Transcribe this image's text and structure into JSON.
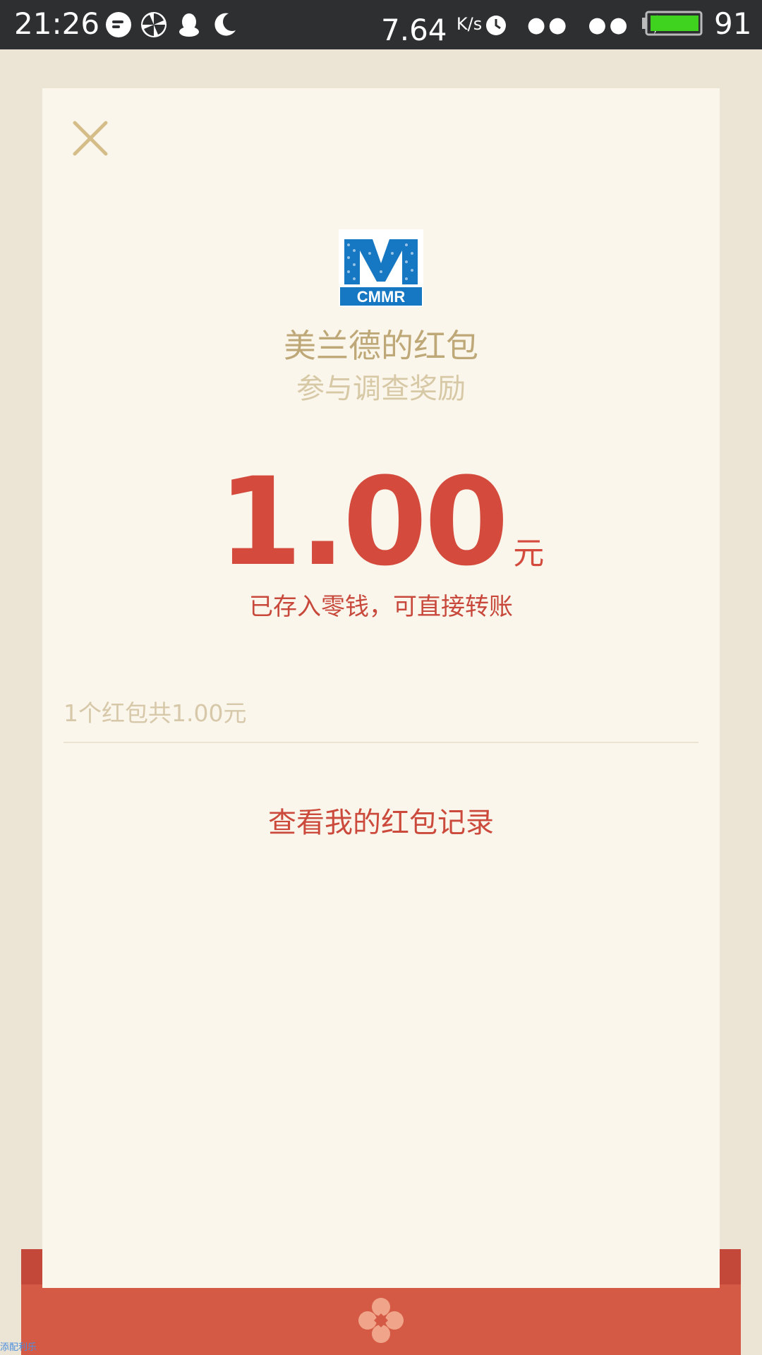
{
  "status_bar": {
    "time": "21:26",
    "net_speed": "7.64",
    "net_speed_unit": "K/s",
    "battery_level": "91",
    "battery_color": "#3fd21f",
    "icons": [
      "message-icon",
      "pinwheel-icon",
      "qq-icon",
      "moon-icon",
      "alarm-icon",
      "signal-dots-icon",
      "signal-dots-icon",
      "charging-icon",
      "battery-icon"
    ]
  },
  "packet": {
    "logo_text": "CMMR",
    "title": "美兰德的红包",
    "subtitle": "参与调查奖励",
    "amount": "1.00",
    "unit": "元",
    "note": "已存入零钱，可直接转账",
    "summary": "1个红包共1.00元",
    "records_link": "查看我的红包记录"
  },
  "corner_label": "添配利乐",
  "colors": {
    "accent_red": "#d44b3e",
    "gold": "#bfa878",
    "card_bg": "#faf6ec",
    "page_bg": "#ece4d4",
    "envelope_red": "#d45a46"
  }
}
